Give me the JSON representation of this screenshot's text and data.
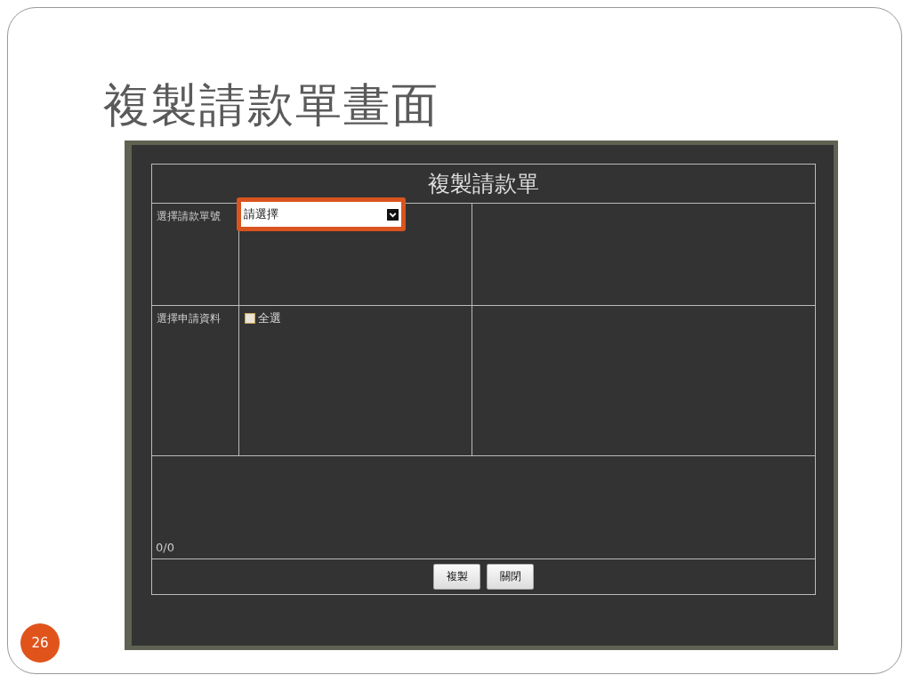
{
  "slide": {
    "title": "複製請款單畫面",
    "page_number": "26"
  },
  "dialog": {
    "title": "複製請款單",
    "order_row": {
      "label": "選擇請款單號",
      "select": {
        "value": "請選擇",
        "highlighted": true
      }
    },
    "data_row": {
      "label": "選擇申請資料",
      "select_all": {
        "label": "全選",
        "checked": false
      }
    },
    "counter": "0/0",
    "buttons": [
      "複製",
      "關閉"
    ]
  }
}
